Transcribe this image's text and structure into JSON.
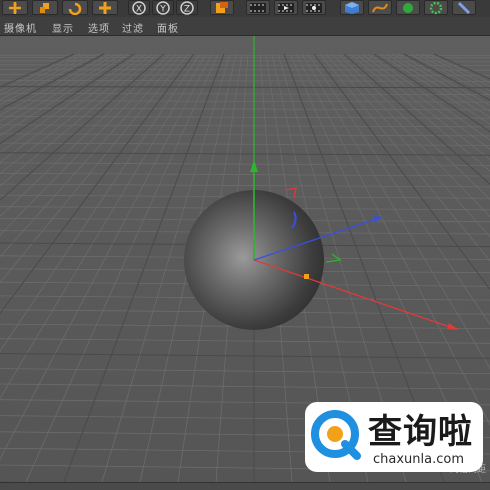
{
  "toolbar": {
    "icons": [
      "move-icon",
      "scale-icon",
      "rotate-icon",
      "add-icon",
      "x-axis-lock-icon",
      "y-axis-lock-icon",
      "z-axis-lock-icon",
      "world-coordinates-icon",
      "render-view-icon",
      "render-picture-viewer-icon",
      "render-settings-icon",
      "cube-icon",
      "spline-pen-icon",
      "nurbs-icon",
      "deformer-icon",
      "scene-icon"
    ],
    "axis_x": "X",
    "axis_y": "Y",
    "axis_z": "Z"
  },
  "menu": {
    "items": [
      "摄像机",
      "显示",
      "选项",
      "过滤",
      "面板"
    ]
  },
  "viewport": {
    "grid_label": "网格间距",
    "object": "sphere"
  },
  "watermark": {
    "chinese": "查询啦",
    "url": "chaxunla.com"
  },
  "colors": {
    "x_axis": "#e03a3a",
    "y_axis": "#2fb52f",
    "z_axis": "#3a4ee0",
    "watermark_accent": "#1f8fe0",
    "watermark_orange": "#f2a11a"
  }
}
